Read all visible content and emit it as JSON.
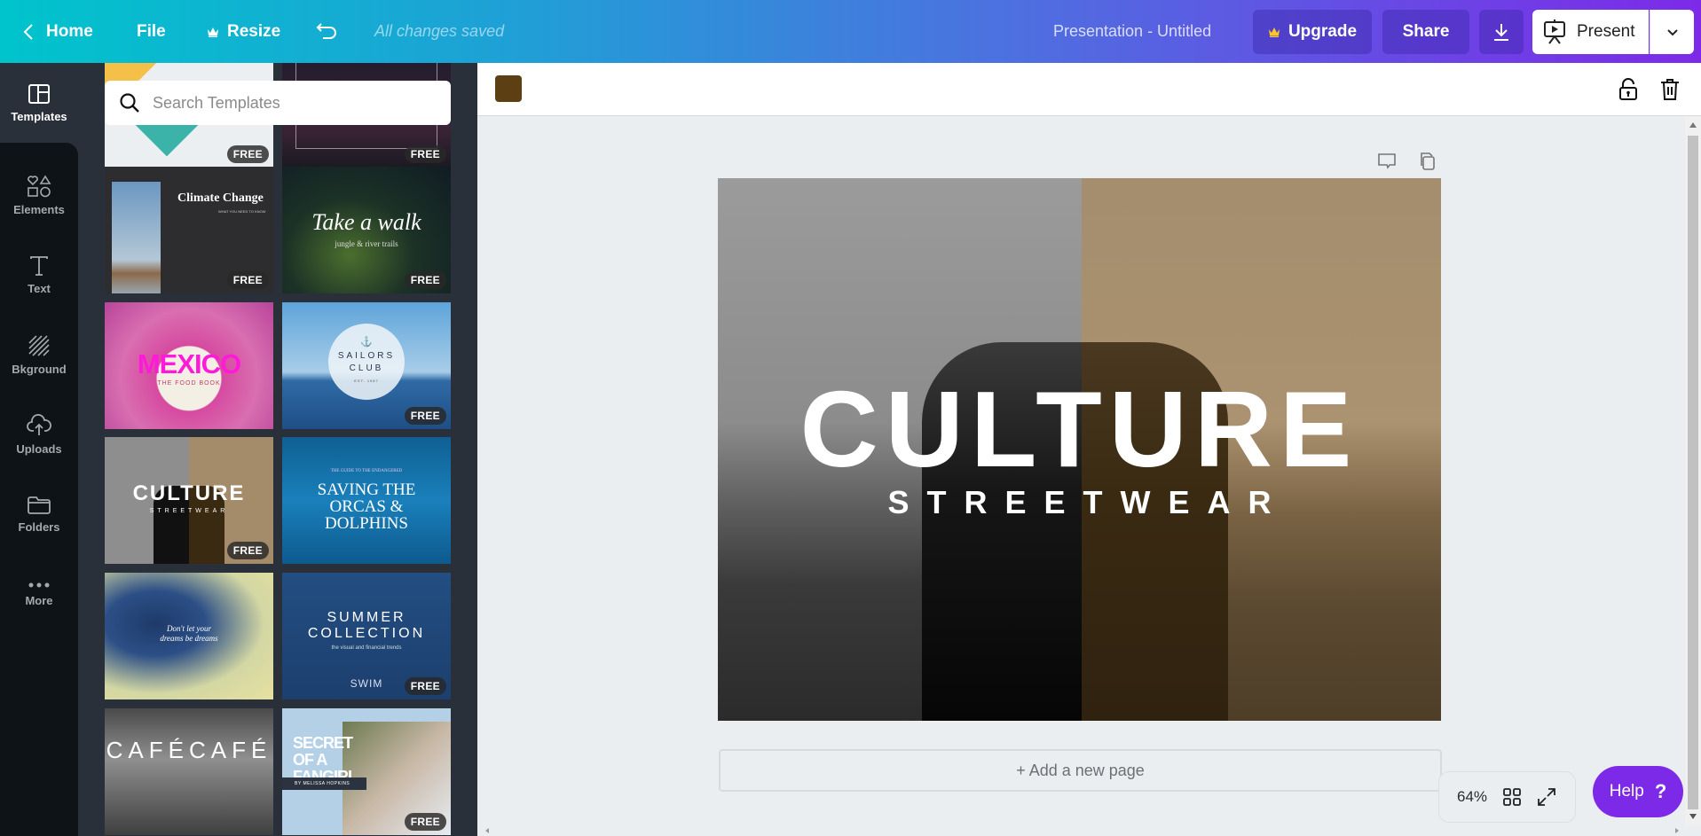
{
  "topbar": {
    "home_label": "Home",
    "file_label": "File",
    "resize_label": "Resize",
    "save_status": "All changes saved",
    "document_title": "Presentation - Untitled",
    "upgrade_label": "Upgrade",
    "share_label": "Share",
    "present_label": "Present"
  },
  "rail": {
    "items": [
      {
        "label": "Templates",
        "icon": "templates-icon",
        "active": true
      },
      {
        "label": "Elements",
        "icon": "elements-icon"
      },
      {
        "label": "Text",
        "icon": "text-icon"
      },
      {
        "label": "Bkground",
        "icon": "background-icon"
      },
      {
        "label": "Uploads",
        "icon": "upload-cloud-icon"
      },
      {
        "label": "Folders",
        "icon": "folder-icon"
      },
      {
        "label": "More",
        "icon": "more-dots-icon"
      }
    ]
  },
  "panel": {
    "search_placeholder": "Search Templates",
    "badge_label": "FREE",
    "templates": [
      {
        "title": "",
        "subtitle": "",
        "free": true
      },
      {
        "title": "",
        "subtitle": "",
        "free": true
      },
      {
        "title": "Climate Change",
        "subtitle": "WHAT YOU NEED TO KNOW",
        "free": true
      },
      {
        "title": "Take a walk",
        "subtitle": "jungle & river trails",
        "free": true
      },
      {
        "title": "MEXICO",
        "subtitle": "THE FOOD BOOK",
        "free": false
      },
      {
        "title": "SAILORS CLUB",
        "subtitle": "EST. 1987",
        "free": true
      },
      {
        "title": "CULTURE",
        "subtitle": "STREETWEAR",
        "free": true
      },
      {
        "title": "SAVING THE ORCAS & DOLPHINS",
        "subtitle": "THE GUIDE TO THE ENDANGERED",
        "free": false
      },
      {
        "title": "Don't let your dreams be dreams",
        "subtitle": "",
        "free": false
      },
      {
        "title": "SUMMER COLLECTION",
        "subtitle": "the visual and financial trends",
        "brand": "SWIM",
        "free": true
      },
      {
        "title": "CAFÉCAFÉ",
        "subtitle": "",
        "free": false
      },
      {
        "title": "SECRET OF A FANGIRL",
        "subtitle": "BY MELISSA HOPKINS",
        "free": true
      }
    ]
  },
  "editor": {
    "swatch_color": "#5c4013",
    "canvas": {
      "title": "CULTURE",
      "subtitle": "STREETWEAR"
    },
    "add_page_label": "+ Add a new page",
    "zoom_level": "64%",
    "help_label": "Help",
    "help_glyph": "?"
  },
  "colors": {
    "brand_purple": "#7d2ae8",
    "brand_teal": "#00c4cc",
    "panel_bg": "#293039",
    "rail_bg": "#0e1318"
  }
}
